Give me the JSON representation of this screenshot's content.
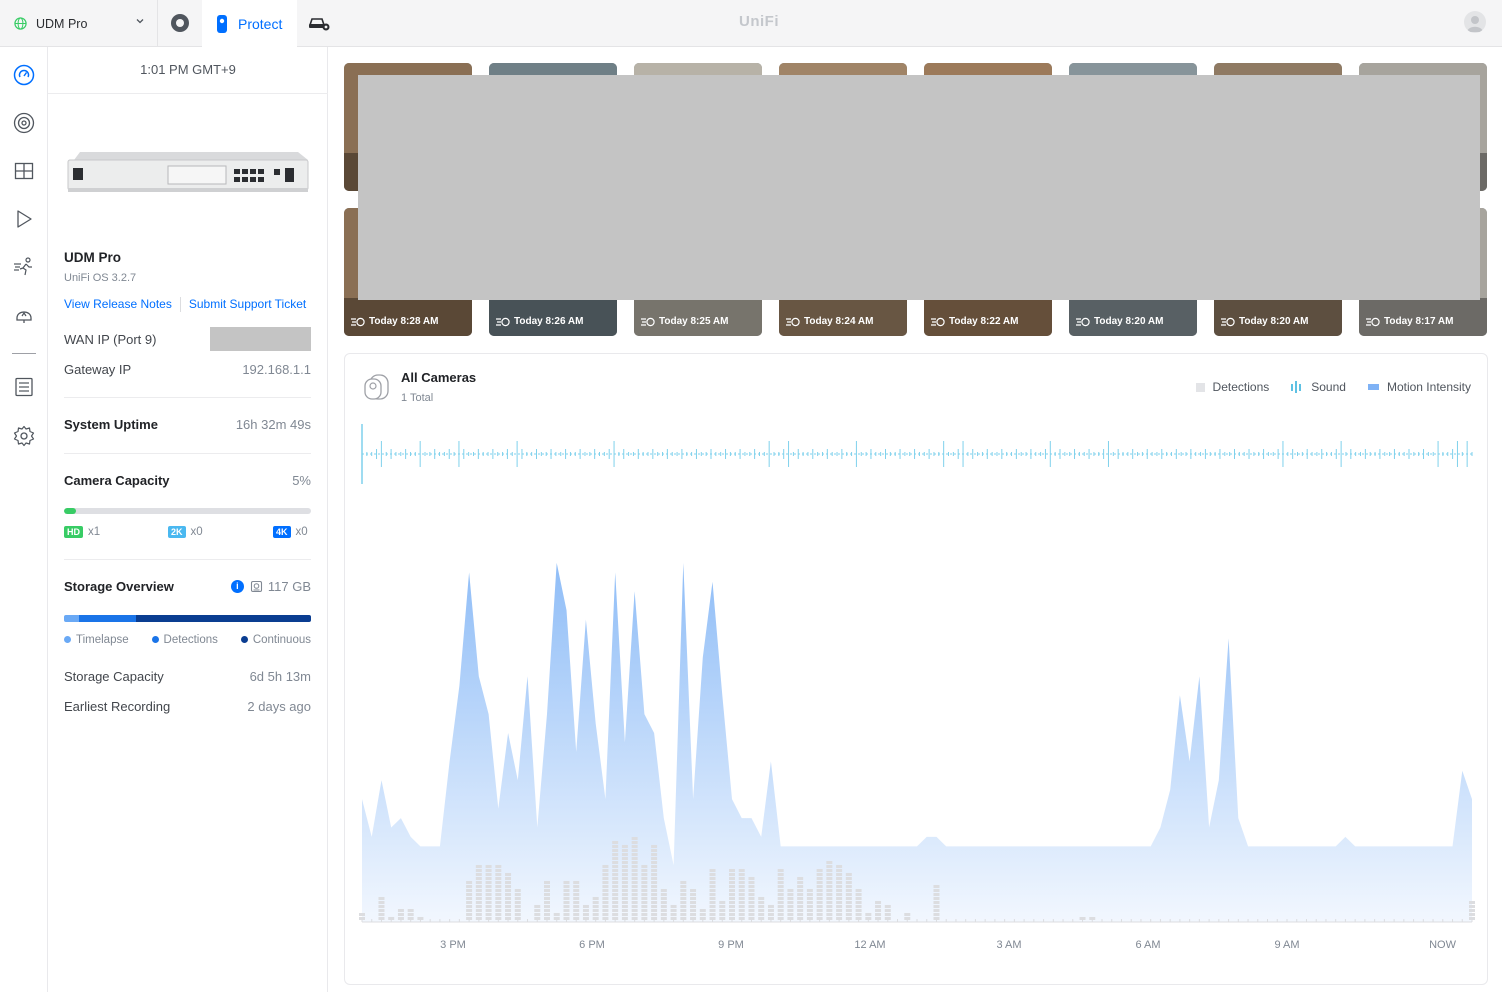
{
  "topbar": {
    "console_name": "UDM Pro",
    "app_tab": "Protect",
    "brand": "UniFi"
  },
  "sidebar_nav": [
    "dashboard-icon",
    "camera-icon",
    "grid-icon",
    "play-icon",
    "detections-icon",
    "alarm-icon",
    "logs-icon",
    "settings-icon"
  ],
  "panel": {
    "time": "1:01 PM GMT+9",
    "device_name": "UDM Pro",
    "os_version": "UniFi OS 3.2.7",
    "link_release_notes": "View Release Notes",
    "link_support": "Submit Support Ticket",
    "wan_label": "WAN IP (Port 9)",
    "gateway_label": "Gateway IP",
    "gateway_value": "192.168.1.1",
    "uptime_label": "System Uptime",
    "uptime_value": "16h 32m 49s",
    "capacity_label": "Camera Capacity",
    "capacity_value": "5%",
    "capacity_fraction": 0.05,
    "res": [
      {
        "badge": "HD",
        "count": "x1",
        "color": "#38cc65"
      },
      {
        "badge": "2K",
        "count": "x0",
        "color": "#4ab8f0"
      },
      {
        "badge": "4K",
        "count": "x0",
        "color": "#006fff"
      }
    ],
    "storage_label": "Storage Overview",
    "storage_value": "117 GB",
    "storage_split": {
      "timelapse": 0.06,
      "detections": 0.23,
      "continuous": 0.71
    },
    "legend_timelapse": "Timelapse",
    "legend_detections": "Detections",
    "legend_continuous": "Continuous",
    "storage_capacity_label": "Storage Capacity",
    "storage_capacity_value": "6d 5h 13m",
    "earliest_label": "Earliest Recording",
    "earliest_value": "2 days ago",
    "colors": {
      "timelapse": "#6aa9f5",
      "detections": "#1a74e8",
      "continuous": "#0a3d91"
    }
  },
  "thumbnails": [
    {
      "label": "Today 8:28 AM"
    },
    {
      "label": "Today 8:26 AM"
    },
    {
      "label": "Today 8:25 AM"
    },
    {
      "label": "Today 8:24 AM"
    },
    {
      "label": "Today 8:22 AM"
    },
    {
      "label": "Today 8:20 AM"
    },
    {
      "label": "Today 8:20 AM"
    },
    {
      "label": "Today 8:17 AM"
    }
  ],
  "activity": {
    "title": "All Cameras",
    "subtitle": "1 Total",
    "legend": [
      "Detections",
      "Sound",
      "Motion Intensity"
    ]
  },
  "chart_data": {
    "type": "area",
    "x_ticks": [
      "3 PM",
      "6 PM",
      "9 PM",
      "12 AM",
      "3 AM",
      "6 AM",
      "9 AM",
      "NOW"
    ],
    "series": [
      {
        "name": "Motion Intensity",
        "values": [
          13,
          9,
          15,
          10,
          11,
          9,
          8,
          8,
          8,
          17,
          25,
          37,
          26,
          22,
          12,
          20,
          15,
          26,
          10,
          22,
          38,
          33,
          18,
          32,
          21,
          13,
          37,
          19,
          35,
          22,
          20,
          11,
          6,
          38,
          13,
          28,
          36,
          24,
          13,
          11,
          11,
          9,
          17,
          8,
          8,
          8,
          8,
          8,
          8,
          8,
          8,
          8,
          8,
          8,
          8,
          8,
          8,
          8,
          9,
          9,
          8,
          8,
          8,
          8,
          8,
          8,
          8,
          8,
          8,
          8,
          8,
          8,
          8,
          8,
          8,
          8,
          8,
          8,
          8,
          8,
          8,
          8,
          10,
          14,
          24,
          17,
          26,
          10,
          15,
          30,
          11,
          8,
          8,
          8,
          8,
          8,
          8,
          8,
          8,
          8,
          8,
          9,
          8,
          8,
          8,
          8,
          8,
          8,
          8,
          8,
          8,
          8,
          8,
          16,
          13
        ]
      },
      {
        "name": "Detections",
        "values": [
          2,
          0,
          6,
          1,
          3,
          3,
          1,
          0,
          0,
          0,
          0,
          10,
          14,
          14,
          14,
          12,
          8,
          0,
          4,
          10,
          2,
          10,
          10,
          4,
          6,
          14,
          20,
          19,
          21,
          14,
          19,
          8,
          4,
          10,
          8,
          3,
          13,
          5,
          13,
          13,
          11,
          6,
          4,
          13,
          8,
          11,
          8,
          13,
          15,
          14,
          12,
          8,
          2,
          5,
          4,
          0,
          2,
          0,
          0,
          9,
          0,
          0,
          0,
          0,
          0,
          0,
          0,
          0,
          0,
          0,
          0,
          0,
          0,
          0,
          1,
          1,
          0,
          0,
          0,
          0,
          0,
          0,
          0,
          0,
          0,
          0,
          0,
          0,
          0,
          0,
          0,
          0,
          0,
          0,
          0,
          0,
          0,
          0,
          0,
          0,
          0,
          0,
          0,
          0,
          0,
          0,
          0,
          0,
          0,
          0,
          0,
          0,
          0,
          0,
          5
        ]
      },
      {
        "name": "Sound",
        "values": [
          0,
          0,
          1,
          0,
          0,
          0,
          1,
          0,
          0,
          0,
          1,
          0,
          0,
          0,
          0,
          0,
          1,
          0,
          0,
          0,
          0,
          0,
          0,
          0,
          0,
          0,
          1,
          0,
          0,
          0,
          0,
          0,
          0,
          0,
          0,
          0,
          0,
          0,
          0,
          0,
          0,
          0,
          1,
          0,
          1,
          0,
          0,
          0,
          0,
          0,
          0,
          1,
          0,
          0,
          0,
          0,
          0,
          0,
          0,
          0,
          1,
          0,
          1,
          0,
          0,
          0,
          0,
          0,
          0,
          0,
          0,
          1,
          0,
          0,
          0,
          0,
          0,
          1,
          0,
          0,
          0,
          0,
          0,
          0,
          0,
          0,
          0,
          0,
          0,
          0,
          0,
          0,
          0,
          0,
          0,
          1,
          0,
          0,
          0,
          0,
          0,
          1,
          0,
          0,
          0,
          0,
          0,
          0,
          0,
          0,
          0,
          1,
          0,
          1,
          1
        ]
      }
    ],
    "xlabel": "",
    "ylabel": ""
  }
}
